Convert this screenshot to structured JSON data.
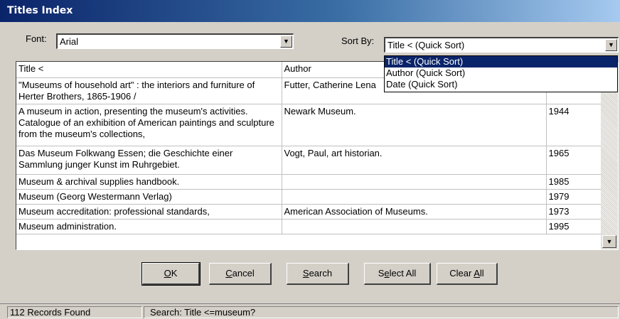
{
  "window": {
    "title": "Titles Index"
  },
  "font": {
    "label": "Font:",
    "value": "Arial"
  },
  "sort": {
    "label": "Sort By:",
    "value": "Title < (Quick Sort)",
    "options": [
      "Title < (Quick Sort)",
      "Author (Quick Sort)",
      "Date (Quick Sort)"
    ],
    "selected_index": 0
  },
  "table": {
    "headers": [
      "Title <",
      "Author",
      ""
    ],
    "rows": [
      {
        "title": "\"Museums of household art\" : the interiors and furniture of Herter Brothers, 1865-1906 /",
        "author": "Futter, Catherine Lena",
        "date": ""
      },
      {
        "title": "A museum in action, presenting the museum's activities. Catalogue of an exhibition of American paintings and sculpture from the museum's collections,",
        "author": "Newark Museum.",
        "date": "1944"
      },
      {
        "title": "Das Museum Folkwang Essen; die Geschichte einer Sammlung junger Kunst im Ruhrgebiet.",
        "author": "Vogt, Paul, art historian.",
        "date": "1965"
      },
      {
        "title": "Museum & archival supplies handbook.",
        "author": "",
        "date": "1985"
      },
      {
        "title": "Museum (Georg Westermann Verlag)",
        "author": "",
        "date": "1979"
      },
      {
        "title": "Museum accreditation: professional standards,",
        "author": "American Association of Museums.",
        "date": "1973"
      },
      {
        "title": "Museum administration.",
        "author": "",
        "date": "1995"
      }
    ]
  },
  "buttons": {
    "ok": {
      "mnemonic": "O",
      "rest": "K"
    },
    "cancel": {
      "mnemonic": "C",
      "rest": "ancel"
    },
    "search": {
      "mnemonic": "S",
      "rest": "earch"
    },
    "select_all": {
      "pre": "S",
      "mnemonic": "e",
      "rest": "lect All"
    },
    "clear_all": {
      "pre": "Clear ",
      "mnemonic": "A",
      "rest": "ll"
    }
  },
  "status": {
    "records": "112 Records Found",
    "search": "Search: Title <=museum?"
  }
}
